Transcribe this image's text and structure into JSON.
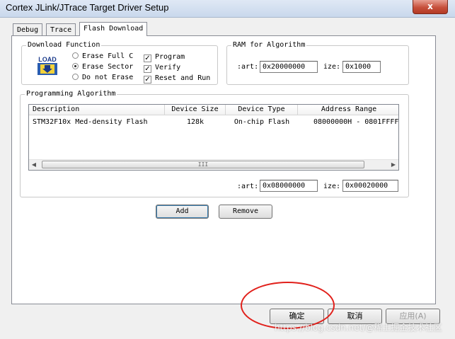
{
  "window": {
    "title": "Cortex JLink/JTrace Target Driver Setup",
    "close_glyph": "x"
  },
  "tabs": [
    {
      "label": "Debug"
    },
    {
      "label": "Trace"
    },
    {
      "label": "Flash Download"
    }
  ],
  "download_function": {
    "title": "Download Function",
    "icon": "load-icon",
    "icon_text": "LOAD",
    "options": [
      {
        "label": "Erase Full C",
        "selected": false
      },
      {
        "label": "Erase Sector",
        "selected": true
      },
      {
        "label": "Do not Erase",
        "selected": false
      }
    ],
    "checks": [
      {
        "label": "Program",
        "checked": true
      },
      {
        "label": "Verify",
        "checked": true
      },
      {
        "label": "Reset and Run",
        "checked": true
      }
    ]
  },
  "ram": {
    "title": "RAM for Algorithm",
    "start_label": ":art:",
    "start_value": "0x20000000",
    "size_label": "ize:",
    "size_value": "0x1000"
  },
  "programming_algorithm": {
    "title": "Programming Algorithm",
    "columns": [
      "Description",
      "Device Size",
      "Device Type",
      "Address Range"
    ],
    "rows": [
      [
        "STM32F10x Med-density Flash",
        "128k",
        "On-chip Flash",
        "08000000H - 0801FFFF"
      ]
    ],
    "start_label": ":art:",
    "start_value": "0x08000000",
    "size_label": "ize:",
    "size_value": "0x00020000",
    "scroll_thumb_glyph": "III"
  },
  "buttons": {
    "add": "Add",
    "remove": "Remove",
    "ok": "确定",
    "cancel": "取消",
    "apply": "应用(A)"
  },
  "watermark": "https://blog.csdn.net/@稀土掘金技术社区",
  "colors": {
    "annotation_circle": "#e1201b",
    "close_button": "#c7503c"
  }
}
